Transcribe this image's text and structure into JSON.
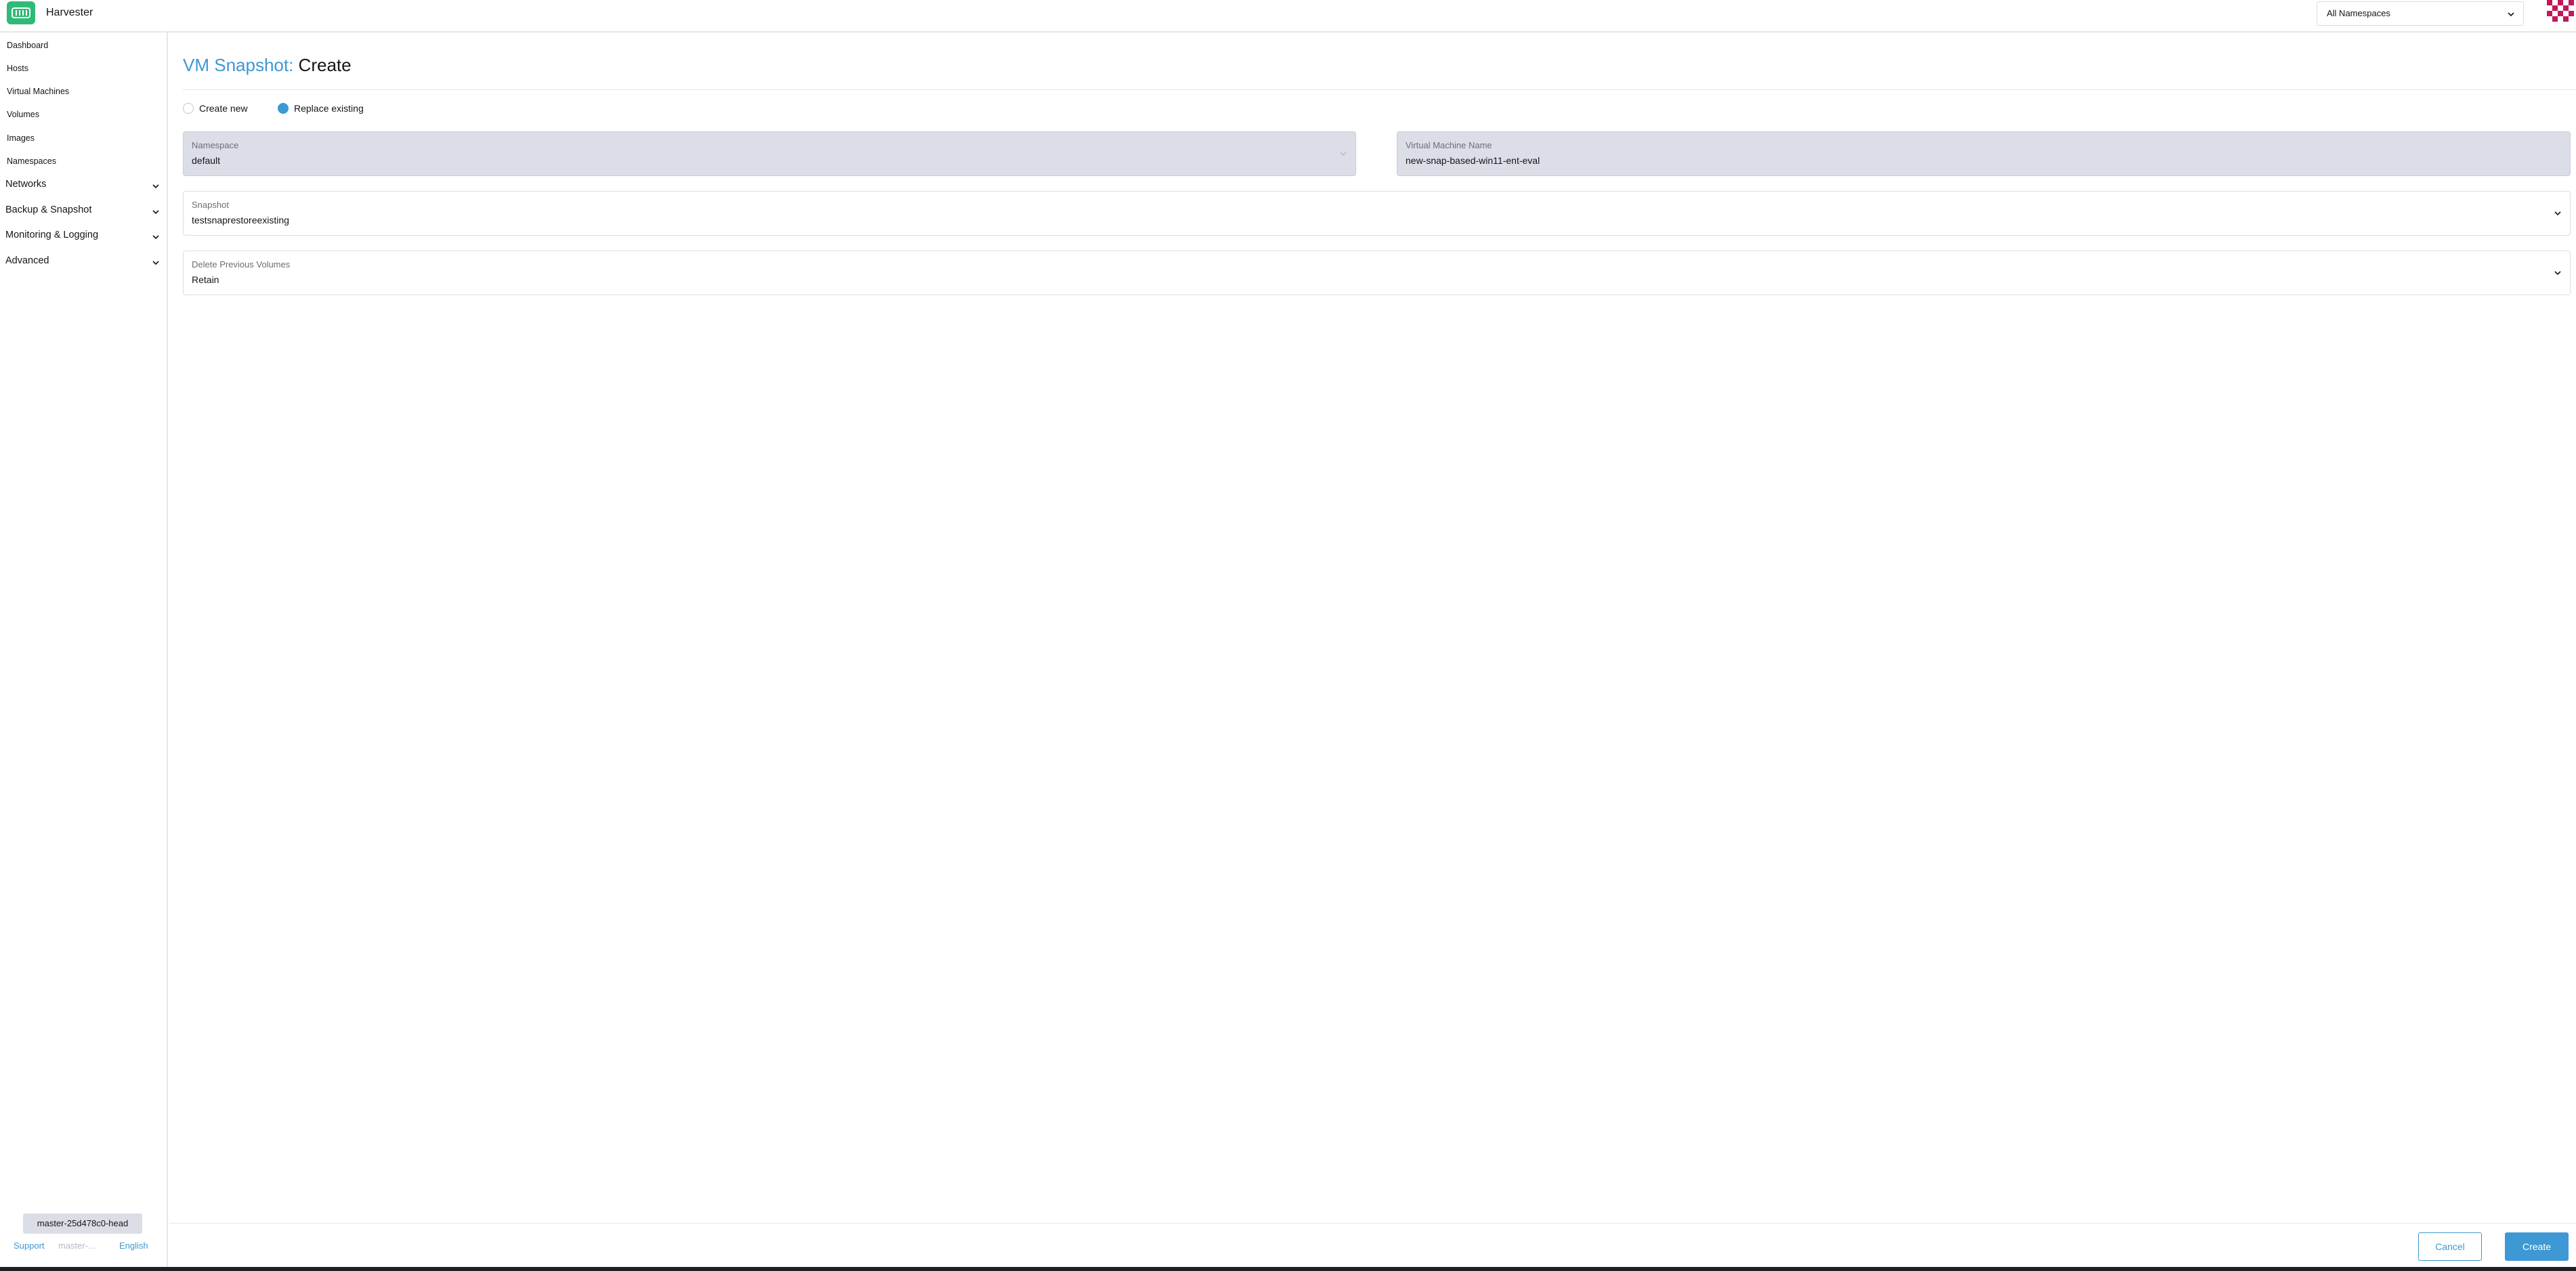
{
  "header": {
    "app_title": "Harvester",
    "namespace_selector": "All Namespaces"
  },
  "sidebar": {
    "items": [
      {
        "label": "Dashboard"
      },
      {
        "label": "Hosts"
      },
      {
        "label": "Virtual Machines"
      },
      {
        "label": "Volumes"
      },
      {
        "label": "Images"
      },
      {
        "label": "Namespaces"
      }
    ],
    "groups": [
      {
        "label": "Networks"
      },
      {
        "label": "Backup & Snapshot"
      },
      {
        "label": "Monitoring & Logging"
      },
      {
        "label": "Advanced"
      }
    ],
    "version": "master-25d478c0-head",
    "support_link": "Support",
    "version_short": "master-...",
    "language_link": "English"
  },
  "page": {
    "title_prefix": "VM Snapshot:",
    "title_action": "Create",
    "radio_create_new": "Create new",
    "radio_replace_existing": "Replace existing",
    "selected_mode": "Replace existing"
  },
  "form": {
    "namespace": {
      "label": "Namespace",
      "value": "default"
    },
    "vm_name": {
      "label": "Virtual Machine Name",
      "value": "new-snap-based-win11-ent-eval"
    },
    "snapshot": {
      "label": "Snapshot",
      "value": "testsnaprestoreexisting"
    },
    "delete_previous_volumes": {
      "label": "Delete Previous Volumes",
      "value": "Retain"
    }
  },
  "actions": {
    "cancel": "Cancel",
    "create": "Create"
  },
  "colors": {
    "accent": "#3d98d3",
    "brand": "#30ba78",
    "disabled_field": "#dcdee7"
  }
}
